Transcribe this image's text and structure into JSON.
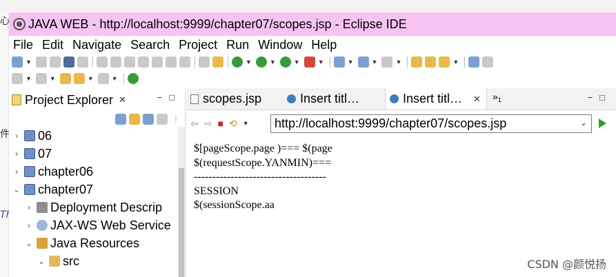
{
  "window": {
    "title": "JAVA WEB - http://localhost:9999/chapter07/scopes.jsp - Eclipse IDE",
    "left_edge_glyphs": [
      "心",
      "件",
      "Th"
    ]
  },
  "menu": [
    "File",
    "Edit",
    "Navigate",
    "Search",
    "Project",
    "Run",
    "Window",
    "Help"
  ],
  "explorer": {
    "title": "Project Explorer",
    "close": "✕",
    "tree": [
      {
        "label": "06",
        "expanded": false,
        "icon": "project-icon"
      },
      {
        "label": "07",
        "expanded": false,
        "icon": "project-icon"
      },
      {
        "label": "chapter06",
        "expanded": false,
        "icon": "project-icon"
      },
      {
        "label": "chapter07",
        "expanded": true,
        "icon": "project-icon"
      },
      {
        "label": "Deployment Descrip",
        "expanded": false,
        "icon": "deployment-descriptor-icon"
      },
      {
        "label": "JAX-WS Web Service",
        "expanded": false,
        "icon": "web-service-icon"
      },
      {
        "label": "Java Resources",
        "expanded": true,
        "icon": "java-resources-icon"
      },
      {
        "label": "src",
        "expanded": true,
        "icon": "source-folder-icon"
      }
    ]
  },
  "editor": {
    "tabs": [
      {
        "label": "scopes.jsp",
        "icon": "jsp-file-icon",
        "active": false
      },
      {
        "label": "Insert titl…",
        "icon": "browser-globe-icon",
        "active": false
      },
      {
        "label": "Insert titl…",
        "icon": "browser-globe-icon",
        "active": true
      }
    ],
    "overflow_label": "»",
    "overflow_count": "1",
    "tab_close": "✕",
    "url": "http://localhost:9999/chapter07/scopes.jsp",
    "content_lines": [
      "$[pageScope.page )=== $(page",
      "$(requestScope.YANMIN)===",
      "------------------------------------",
      "SESSION",
      "$(sessionScope.aa"
    ]
  },
  "watermark": "CSDN @颜悦扬"
}
